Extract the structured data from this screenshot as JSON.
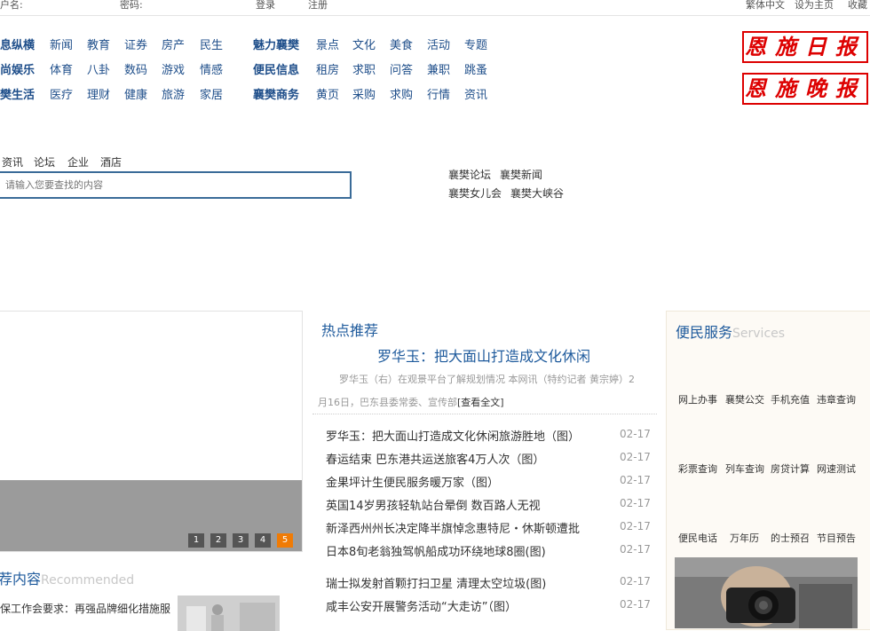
{
  "topbar": {
    "username_label": "户名:",
    "password_label": "密码:",
    "login": "登录",
    "register": "注册",
    "lang": "繁体中文",
    "set_home": "设为主页",
    "bookmark": "收藏"
  },
  "nav": {
    "row1": [
      "息纵横",
      "新闻",
      "教育",
      "证券",
      "房产",
      "民生",
      "魅力襄樊",
      "景点",
      "文化",
      "美食",
      "活动",
      "专题"
    ],
    "row2": [
      "尚娱乐",
      "体育",
      "八卦",
      "数码",
      "游戏",
      "情感",
      "便民信息",
      "租房",
      "求职",
      "问答",
      "兼职",
      "跳蚤"
    ],
    "row3": [
      "樊生活",
      "医疗",
      "理财",
      "健康",
      "旅游",
      "家居",
      "襄樊商务",
      "黄页",
      "采购",
      "求购",
      "行情",
      "资讯"
    ]
  },
  "logos": {
    "daily": "恩施日报",
    "evening": "恩施晚报"
  },
  "search": {
    "tabs": [
      "资讯",
      "论坛",
      "企业",
      "酒店"
    ],
    "placeholder": "请输入您要查找的内容"
  },
  "hot_links": [
    "襄樊论坛",
    "襄樊新闻",
    "襄樊女儿会",
    "襄樊大峡谷"
  ],
  "slideshow": {
    "pages": [
      "1",
      "2",
      "3",
      "4",
      "5"
    ],
    "active_page": 5
  },
  "hot": {
    "title": "热点推荐",
    "headline": "罗华玉：把大面山打造成文化休闲",
    "summary": "罗华玉（右）在观景平台了解规划情况 本网讯（特约记者 黄宗婷）2月16日，巴东县委常委、宣传部",
    "more": "[查看全文]",
    "news": [
      {
        "title": "罗华玉：把大面山打造成文化休闲旅游胜地（图）",
        "date": "02-17"
      },
      {
        "title": "春运结束 巴东港共运送旅客4万人次（图）",
        "date": "02-17"
      },
      {
        "title": "金果坪计生便民服务暖万家（图）",
        "date": "02-17"
      },
      {
        "title": "英国14岁男孩轻轨站台晕倒 数百路人无视",
        "date": "02-17"
      },
      {
        "title": "新泽西州州长决定降半旗悼念惠特尼・休斯顿遭批",
        "date": "02-17"
      },
      {
        "title": "日本8旬老翁独驾帆船成功环绕地球8圈(图)",
        "date": "02-17"
      },
      {
        "title": "瑞士拟发射首颗打扫卫星 清理太空垃圾(图)",
        "date": "02-17"
      },
      {
        "title": "咸丰公安开展警务活动“大走访”（图）",
        "date": "02-17"
      }
    ]
  },
  "services": {
    "title": "便民服务",
    "title_en": "Services",
    "row1": [
      "网上办事",
      "襄樊公交",
      "手机充值",
      "违章查询"
    ],
    "row2": [
      "彩票查询",
      "列车查询",
      "房贷计算",
      "网速测试"
    ],
    "row3": [
      "便民电话",
      "万年历",
      "的士预召",
      "节目预告"
    ]
  },
  "recommended": {
    "title": "荐内容",
    "title_en": "Recommended",
    "item": "保工作会要求：再强品牌细化措施服"
  }
}
